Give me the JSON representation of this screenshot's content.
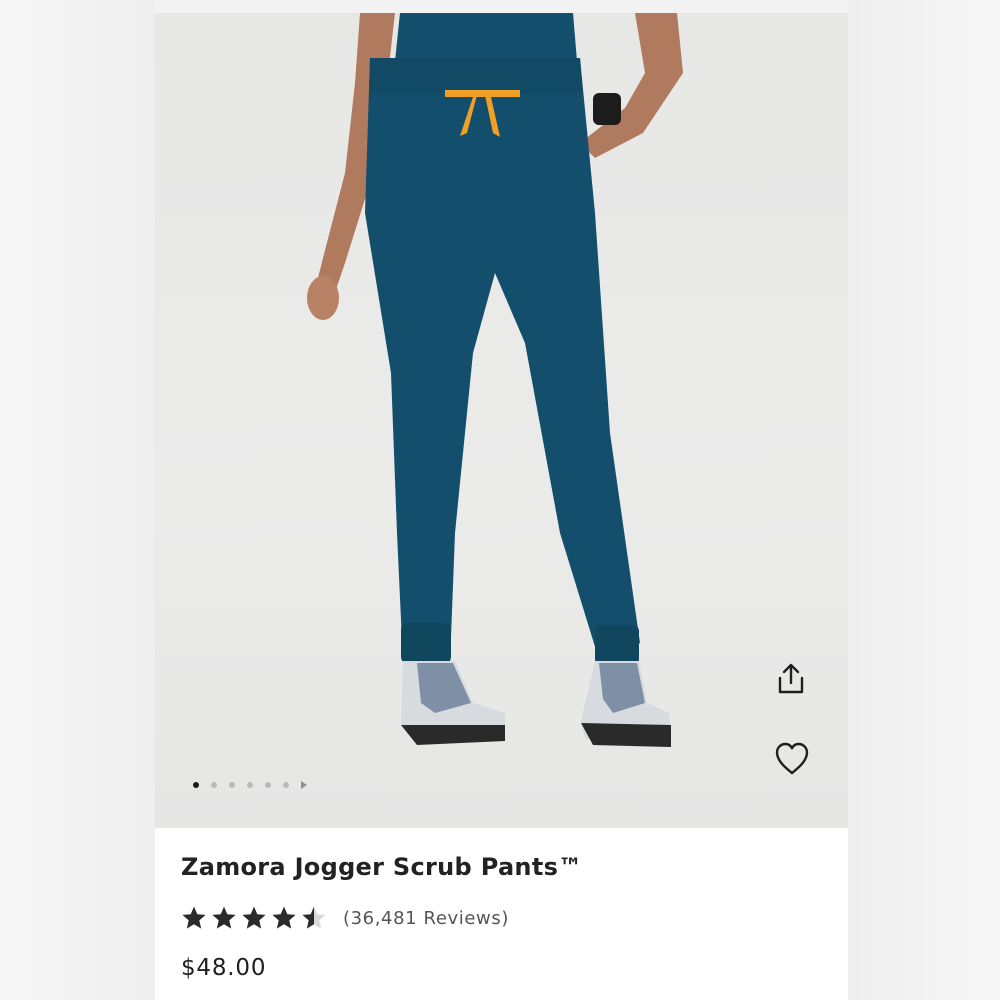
{
  "product": {
    "name": "Zamora Jogger Scrub Pants™",
    "rating": 4.5,
    "rating_max": 5,
    "reviews_text": "(36,481 Reviews)",
    "price": "$48.00"
  },
  "gallery": {
    "image_count": 6,
    "active_index": 0,
    "image_subject": "product-photo"
  },
  "actions": {
    "share_icon": "share-icon",
    "favorite_icon": "heart-icon"
  },
  "colors": {
    "pant": "#134f6c",
    "drawstring": "#f2a023",
    "text": "#222222",
    "star": "#2a2a2a"
  }
}
